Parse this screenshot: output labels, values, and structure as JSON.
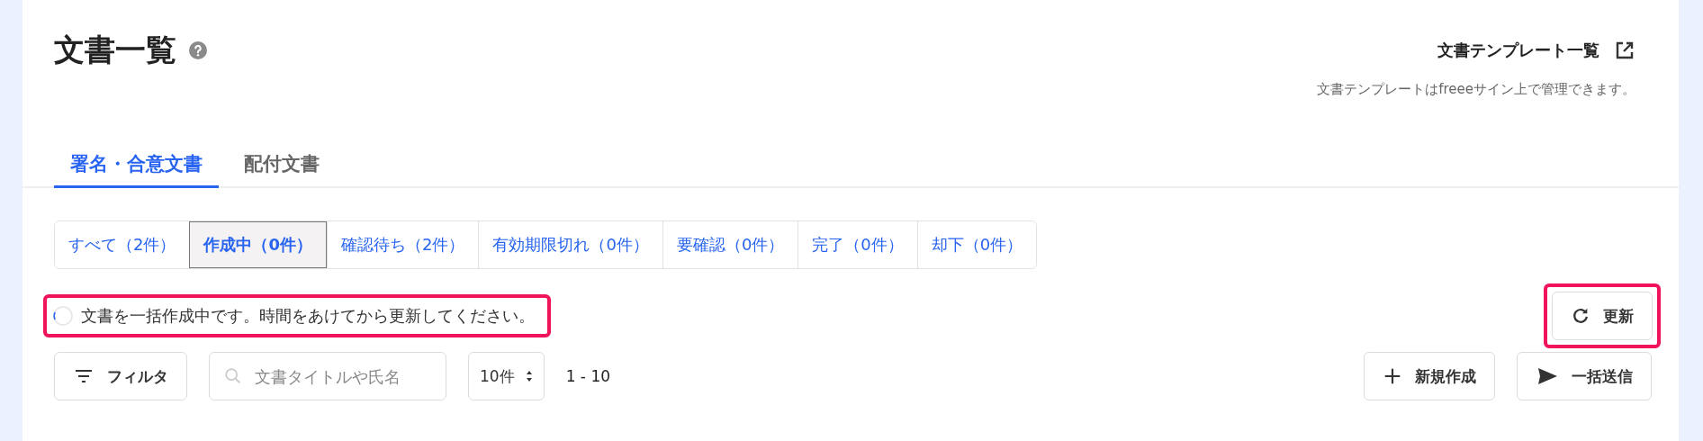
{
  "page": {
    "title": "文書一覧"
  },
  "template_link": {
    "label": "文書テンプレート一覧",
    "note": "文書テンプレートはfreeeサイン上で管理できます。"
  },
  "tabs": [
    {
      "label": "署名・合意文書",
      "selected": true
    },
    {
      "label": "配付文書",
      "selected": false
    }
  ],
  "status_filters": [
    {
      "label": "すべて（2件）",
      "selected": false
    },
    {
      "label": "作成中（0件）",
      "selected": true
    },
    {
      "label": "確認待ち（2件）",
      "selected": false
    },
    {
      "label": "有効期限切れ（0件）",
      "selected": false
    },
    {
      "label": "要確認（0件）",
      "selected": false
    },
    {
      "label": "完了（0件）",
      "selected": false
    },
    {
      "label": "却下（0件）",
      "selected": false
    }
  ],
  "notice": {
    "text": "文書を一括作成中です。時間をあけてから更新してください。",
    "highlighted": true
  },
  "refresh_button": {
    "label": "更新",
    "highlighted": true
  },
  "toolbar": {
    "filter_button": "フィルタ",
    "search": {
      "placeholder": "文書タイトルや氏名"
    },
    "per_page": "10件",
    "range": "1 - 10",
    "actions": [
      {
        "kind": "plus",
        "label": "新規作成"
      },
      {
        "kind": "send",
        "label": "一括送信"
      }
    ]
  }
}
